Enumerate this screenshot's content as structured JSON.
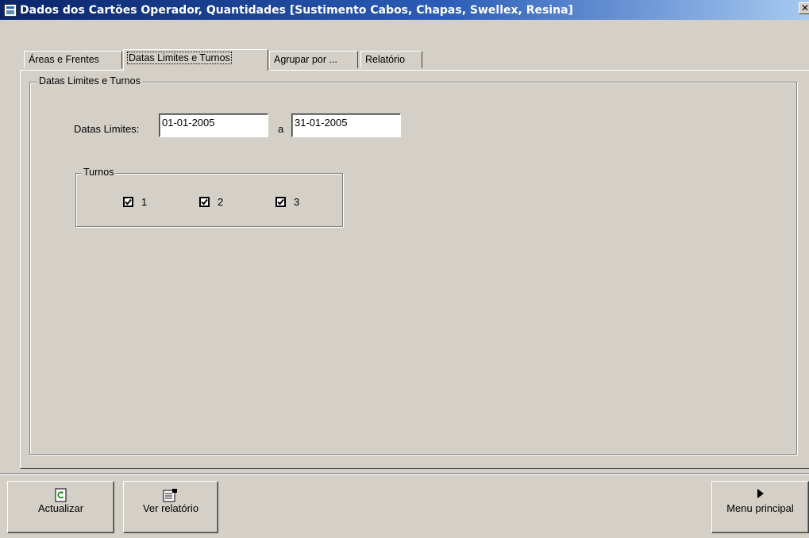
{
  "window": {
    "title": "Dados dos Cartões Operador, Quantidades [Sustimento Cabos, Chapas, Swellex, Resina]",
    "close_label": "x"
  },
  "tabs": [
    {
      "label": "Áreas e Frentes",
      "active": false
    },
    {
      "label": "Datas Limites e Turnos",
      "active": true
    },
    {
      "label": "Agrupar por ...",
      "active": false
    },
    {
      "label": "Relatório",
      "active": false
    }
  ],
  "panel": {
    "group_title": "Datas Limites e Turnos",
    "dates": {
      "label": "Datas Limites:",
      "from": "01-01-2005",
      "separator": "a",
      "to": "31-01-2005"
    },
    "turnos": {
      "title": "Turnos",
      "items": [
        {
          "label": "1",
          "checked": true
        },
        {
          "label": "2",
          "checked": true
        },
        {
          "label": "3",
          "checked": true
        }
      ]
    }
  },
  "buttons": {
    "refresh": {
      "label": "Actualizar",
      "icon": "refresh-icon"
    },
    "report": {
      "label": "Ver relatório",
      "icon": "report-icon"
    },
    "menu": {
      "label": "Menu principal",
      "icon": "play-icon"
    }
  }
}
